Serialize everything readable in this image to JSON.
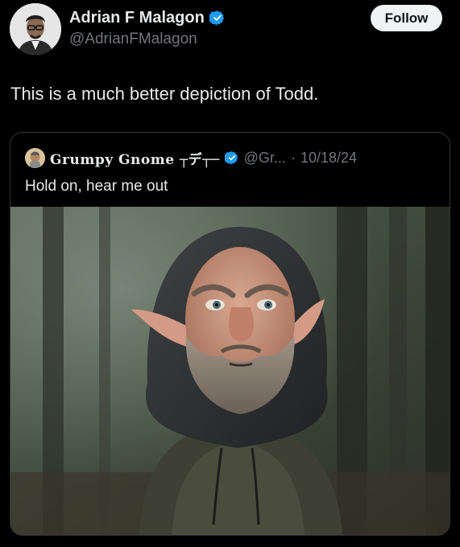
{
  "author": {
    "display_name": "Adrian F Malagon",
    "handle": "@AdrianFMalagon",
    "avatar_icon": "profile-photo-avatar",
    "verified_icon": "verified-badge-icon"
  },
  "follow_button": {
    "label": "Follow"
  },
  "tweet": {
    "text": "This is a much better depiction of Todd."
  },
  "quote": {
    "display_name": "Grumpy Gnome ┬デ┬─",
    "handle_truncated": "@Gr...",
    "separator": "·",
    "date": "10/18/24",
    "text": "Hold on, hear me out",
    "image_icon": "gnome-in-hoodie-photo"
  },
  "colors": {
    "background": "#000000",
    "text_primary": "#e7e9ea",
    "text_secondary": "#71767b",
    "verified_blue": "#1d9bf0",
    "border": "#2f3336",
    "follow_bg": "#eff3f4"
  }
}
